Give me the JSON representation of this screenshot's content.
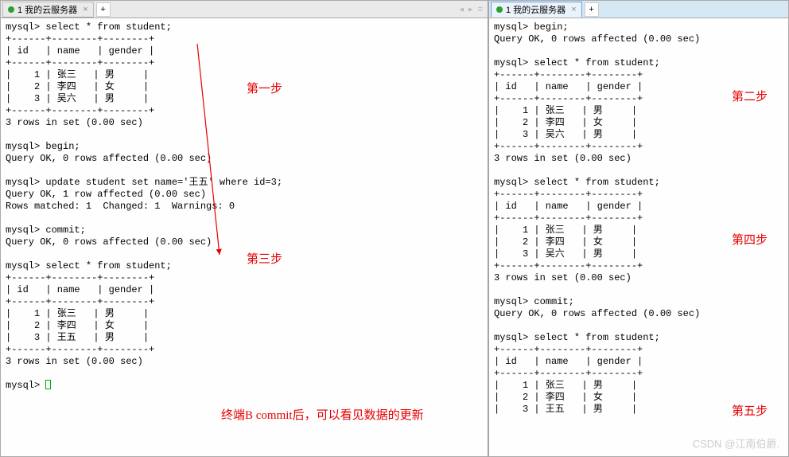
{
  "left": {
    "tab_title": "1 我的云服务器",
    "tab_add_label": "+",
    "nav_prev": "◂",
    "nav_next": "▸",
    "nav_menu": "≡",
    "terminal_text": "mysql> select * from student;\n+------+--------+--------+\n| id   | name   | gender |\n+------+--------+--------+\n|    1 | 张三   | 男     |\n|    2 | 李四   | 女     |\n|    3 | 吴六   | 男     |\n+------+--------+--------+\n3 rows in set (0.00 sec)\n\nmysql> begin;\nQuery OK, 0 rows affected (0.00 sec)\n\nmysql> update student set name='王五' where id=3;\nQuery OK, 1 row affected (0.00 sec)\nRows matched: 1  Changed: 1  Warnings: 0\n\nmysql> commit;\nQuery OK, 0 rows affected (0.00 sec)\n\nmysql> select * from student;\n+------+--------+--------+\n| id   | name   | gender |\n+------+--------+--------+\n|    1 | 张三   | 男     |\n|    2 | 李四   | 女     |\n|    3 | 王五   | 男     |\n+------+--------+--------+\n3 rows in set (0.00 sec)\n\nmysql> "
  },
  "right": {
    "tab_title": "1 我的云服务器",
    "tab_add_label": "+",
    "terminal_text": "mysql> begin;\nQuery OK, 0 rows affected (0.00 sec)\n\nmysql> select * from student;\n+------+--------+--------+\n| id   | name   | gender |\n+------+--------+--------+\n|    1 | 张三   | 男     |\n|    2 | 李四   | 女     |\n|    3 | 吴六   | 男     |\n+------+--------+--------+\n3 rows in set (0.00 sec)\n\nmysql> select * from student;\n+------+--------+--------+\n| id   | name   | gender |\n+------+--------+--------+\n|    1 | 张三   | 男     |\n|    2 | 李四   | 女     |\n|    3 | 吴六   | 男     |\n+------+--------+--------+\n3 rows in set (0.00 sec)\n\nmysql> commit;\nQuery OK, 0 rows affected (0.00 sec)\n\nmysql> select * from student;\n+------+--------+--------+\n| id   | name   | gender |\n+------+--------+--------+\n|    1 | 张三   | 男     |\n|    2 | 李四   | 女     |\n|    3 | 王五   | 男     |"
  },
  "annotations": {
    "step1": "第一步",
    "step2": "第二步",
    "step3": "第三步",
    "step4": "第四步",
    "step5": "第五步",
    "commit_note": "终端B commit后，可以看见数据的更新"
  },
  "watermark": "CSDN @江南伯爵.",
  "close_glyph": "×"
}
